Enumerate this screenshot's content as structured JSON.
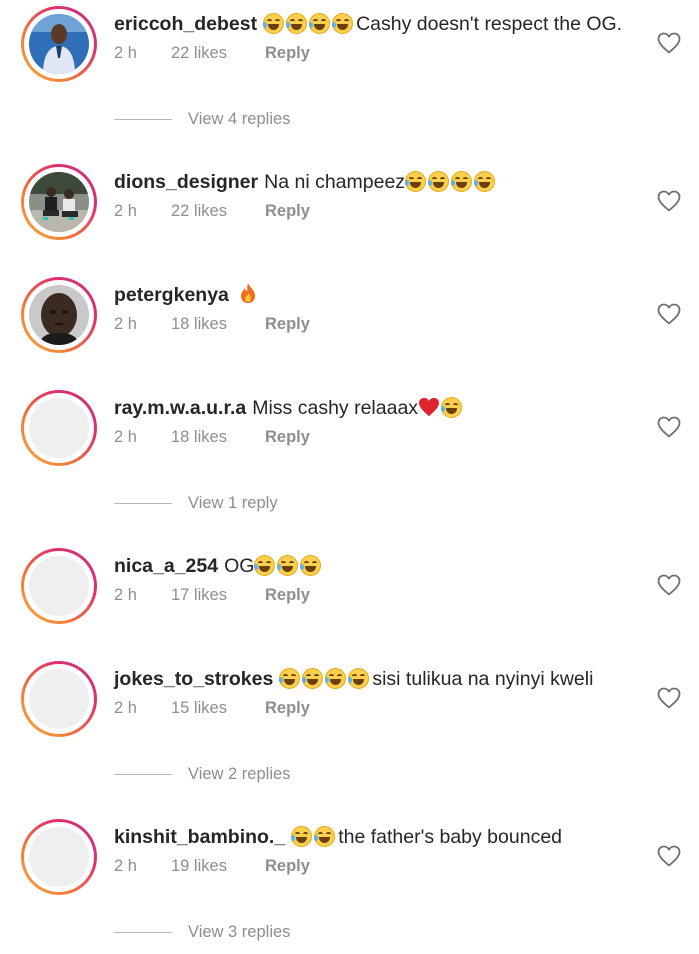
{
  "comments": [
    {
      "username": "ericcoh_debest",
      "emojis_before": 4,
      "text": "Cashy doesn't respect the OG.",
      "time": "2 h",
      "likes": "22 likes",
      "reply_label": "Reply",
      "avatar": "photo-man-blue-shirt",
      "view_replies": "View 4 replies"
    },
    {
      "username": "dions_designer",
      "text": "Na ni champeez",
      "emojis_after": 4,
      "time": "2 h",
      "likes": "22 likes",
      "reply_label": "Reply",
      "avatar": "photo-two-people-sitting"
    },
    {
      "username": "petergkenya",
      "emoji_fire": true,
      "time": "2 h",
      "likes": "18 likes",
      "reply_label": "Reply",
      "avatar": "photo-man-selfie"
    },
    {
      "username": "ray.m.w.a.u.r.a",
      "text": "Miss cashy relaaax",
      "emoji_heart": true,
      "emojis_after": 1,
      "time": "2 h",
      "likes": "18 likes",
      "reply_label": "Reply",
      "avatar": "empty",
      "view_replies": "View 1 reply"
    },
    {
      "username": "nica_a_254",
      "text": "OG",
      "emojis_after": 3,
      "time": "2 h",
      "likes": "17 likes",
      "reply_label": "Reply",
      "avatar": "empty"
    },
    {
      "username": "jokes_to_strokes",
      "emojis_before": 4,
      "text": "sisi tulikua na nyinyi kweli",
      "time": "2 h",
      "likes": "15 likes",
      "reply_label": "Reply",
      "avatar": "empty",
      "view_replies": "View 2 replies"
    },
    {
      "username": "kinshit_bambino._",
      "emojis_before": 2,
      "text": "the father's baby bounced",
      "time": "2 h",
      "likes": "19 likes",
      "reply_label": "Reply",
      "avatar": "empty",
      "view_replies": "View 3 replies"
    }
  ],
  "colors": {
    "ring_start": "#f9b13a",
    "ring_end": "#c13584",
    "meta_text": "#8e8e8e",
    "emoji_yellow": "#fbd04d"
  },
  "icons": {
    "like": "heart-outline-icon",
    "emoji": "laughing-tears-emoji",
    "fire": "fire-emoji",
    "heart": "red-heart-emoji"
  }
}
